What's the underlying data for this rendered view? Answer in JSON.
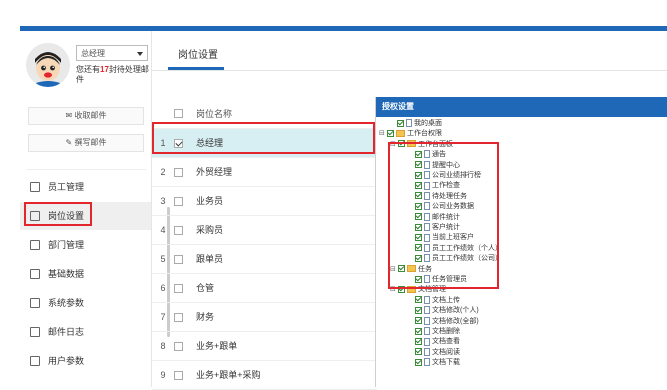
{
  "colors": {
    "accent": "#1f68b8",
    "highlight": "#e3262e",
    "selected_row": "#d7eef3"
  },
  "profile": {
    "role": "总经理",
    "pending_prefix": "您还有",
    "pending_count": "17",
    "pending_suffix": "封待处理邮件"
  },
  "mail": {
    "receive": "收取邮件",
    "write": "撰写邮件"
  },
  "nav": [
    {
      "label": "员工管理",
      "icon": "employee-icon"
    },
    {
      "label": "岗位设置",
      "icon": "position-icon"
    },
    {
      "label": "部门管理",
      "icon": "org-chart-icon"
    },
    {
      "label": "基础数据",
      "icon": "data-icon"
    },
    {
      "label": "系统参数",
      "icon": "settings-icon"
    },
    {
      "label": "邮件日志",
      "icon": "log-icon"
    },
    {
      "label": "用户参数",
      "icon": "user-param-icon"
    }
  ],
  "tab": {
    "label": "岗位设置"
  },
  "table": {
    "header": "岗位名称",
    "rows": [
      {
        "num": "1",
        "name": "总经理",
        "checked": true
      },
      {
        "num": "2",
        "name": "外贸经理",
        "checked": false
      },
      {
        "num": "3",
        "name": "业务员",
        "checked": false
      },
      {
        "num": "4",
        "name": "采购员",
        "checked": false
      },
      {
        "num": "5",
        "name": "跟单员",
        "checked": false
      },
      {
        "num": "6",
        "name": "仓管",
        "checked": false
      },
      {
        "num": "7",
        "name": "财务",
        "checked": false
      },
      {
        "num": "8",
        "name": "业务+跟单",
        "checked": false
      },
      {
        "num": "9",
        "name": "业务+跟单+采购",
        "checked": false
      }
    ]
  },
  "panel": {
    "title": "授权设置"
  },
  "tree": [
    {
      "label": "我的桌面",
      "level": 1,
      "type": "doc",
      "exp": ""
    },
    {
      "label": "工作台权限",
      "level": 1,
      "type": "fold",
      "exp": "⊟"
    },
    {
      "label": "工作台面板",
      "level": 2,
      "type": "fold",
      "exp": "⊟"
    },
    {
      "label": "通告",
      "level": 3,
      "type": "doc",
      "exp": ""
    },
    {
      "label": "提醒中心",
      "level": 3,
      "type": "doc",
      "exp": ""
    },
    {
      "label": "公司业绩排行榜",
      "level": 3,
      "type": "doc",
      "exp": ""
    },
    {
      "label": "工作检查",
      "level": 3,
      "type": "doc",
      "exp": ""
    },
    {
      "label": "待处理任务",
      "level": 3,
      "type": "doc",
      "exp": ""
    },
    {
      "label": "公司业务数据",
      "level": 3,
      "type": "doc",
      "exp": ""
    },
    {
      "label": "邮件统计",
      "level": 3,
      "type": "doc",
      "exp": ""
    },
    {
      "label": "客户统计",
      "level": 3,
      "type": "doc",
      "exp": ""
    },
    {
      "label": "当前上班客户",
      "level": 3,
      "type": "doc",
      "exp": ""
    },
    {
      "label": "员工工作绩效（个人）",
      "level": 3,
      "type": "doc",
      "exp": ""
    },
    {
      "label": "员工工作绩效（公司）",
      "level": 3,
      "type": "doc",
      "exp": ""
    },
    {
      "label": "任务",
      "level": 2,
      "type": "fold",
      "exp": "⊟"
    },
    {
      "label": "任务管理员",
      "level": 3,
      "type": "doc",
      "exp": ""
    },
    {
      "label": "文档管理",
      "level": 2,
      "type": "fold",
      "exp": "⊟"
    },
    {
      "label": "文档上传",
      "level": 3,
      "type": "doc",
      "exp": ""
    },
    {
      "label": "文档修改(个人)",
      "level": 3,
      "type": "doc",
      "exp": ""
    },
    {
      "label": "文档修改(全部)",
      "level": 3,
      "type": "doc",
      "exp": ""
    },
    {
      "label": "文档删除",
      "level": 3,
      "type": "doc",
      "exp": ""
    },
    {
      "label": "文档查看",
      "level": 3,
      "type": "doc",
      "exp": ""
    },
    {
      "label": "文档阅读",
      "level": 3,
      "type": "doc",
      "exp": ""
    },
    {
      "label": "文档下载",
      "level": 3,
      "type": "doc",
      "exp": ""
    }
  ]
}
